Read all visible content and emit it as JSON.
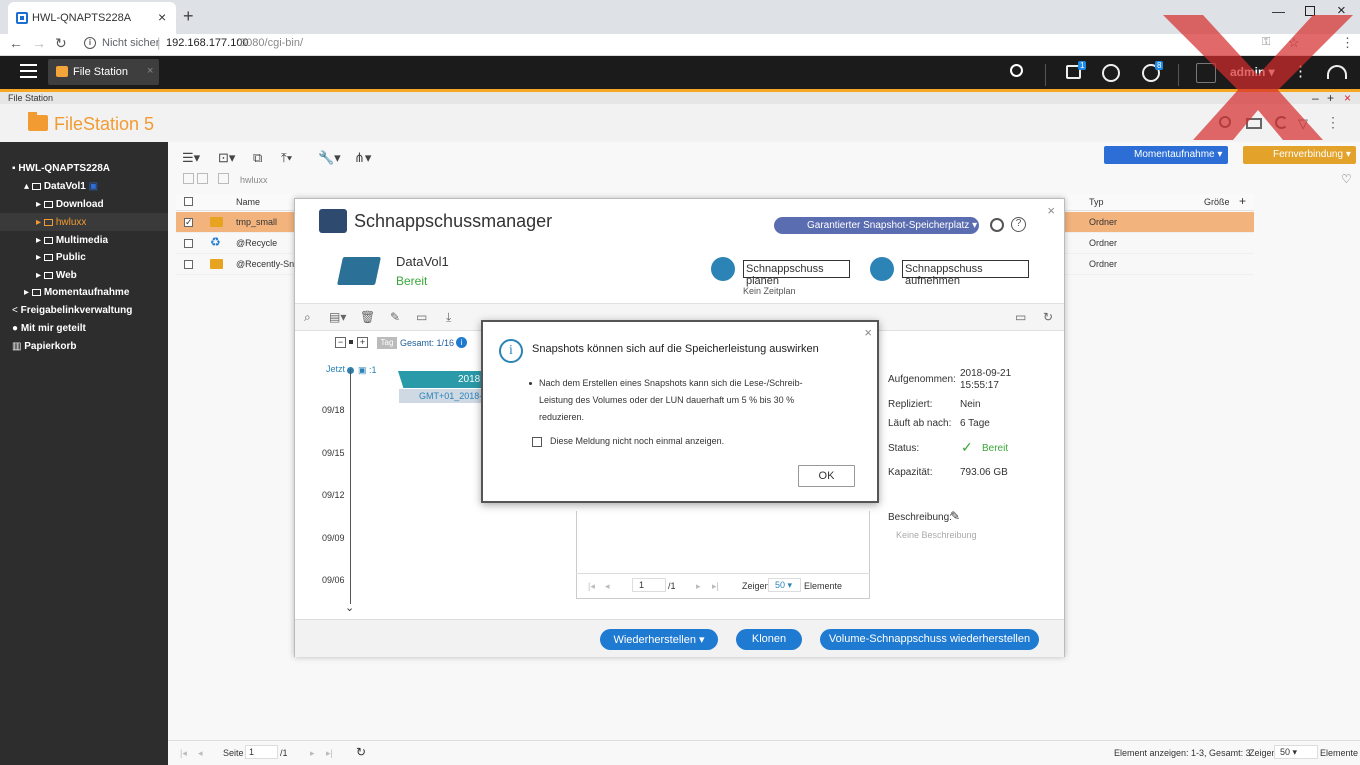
{
  "browser": {
    "tab_title": "HWL-QNAPTS228A",
    "security": "Nicht sicher",
    "url_host": "192.168.177.100",
    "url_path": ":8080/cgi-bin/"
  },
  "qts": {
    "app_tab": "File Station",
    "user": "admin",
    "badge_tasks": "1",
    "badge_info": "8"
  },
  "app": {
    "title_small": "File Station",
    "logo_main": "FileStation",
    "logo_version": " 5"
  },
  "sidebar": {
    "nas": "HWL-QNAPTS228A",
    "volume": "DataVol1",
    "folders": [
      "Download",
      "hwluxx",
      "Multimedia",
      "Public",
      "Web"
    ],
    "momentaufnahme": "Momentaufnahme",
    "freigabe": "Freigabelinkverwaltung",
    "shared": "Mit mir geteilt",
    "trash": "Papierkorb"
  },
  "toolbar": {
    "momentaufnahme_btn": "Momentaufnahme",
    "remote_btn": "Fernverbindung",
    "path": "hwluxx"
  },
  "table": {
    "headers": {
      "name": "Name",
      "type": "Typ",
      "size": "Größe"
    },
    "rows": [
      {
        "name": "tmp_small",
        "type": "Ordner",
        "checked": true
      },
      {
        "name": "@Recycle",
        "type": "Ordner",
        "checked": false
      },
      {
        "name": "@Recently-Snap",
        "type": "Ordner",
        "checked": false
      }
    ]
  },
  "statusbar": {
    "page_label": "Seite",
    "page_value": "1",
    "page_total": "/1",
    "items_info": "Element anzeigen: 1-3, Gesamt: 3",
    "show_label": "Zeigen",
    "show_value": "50",
    "elements_label": "Elemente"
  },
  "snapshot_manager": {
    "title": "Schnappschussmanager",
    "guarantee": "Garantierter Snapshot-Speicherplatz",
    "volume": "DataVol1",
    "volume_status": "Bereit",
    "plan_btn": "Schnappschuss planen",
    "take_btn": "Schnappschuss aufnehmen",
    "no_schedule": "Kein Zeitplan",
    "tag_label": "Tag",
    "total": "Gesamt: 1/16",
    "now": "Jetzt",
    "now_count": "1",
    "timeline_dates": [
      "09/18",
      "09/15",
      "09/12",
      "09/09",
      "09/06"
    ],
    "band_label": "2018",
    "snapshot_name": "GMT+01_2018-",
    "details": {
      "taken_label": "Aufgenommen:",
      "taken_value_1": "2018-09-21",
      "taken_value_2": "15:55:17",
      "replicated_label": "Repliziert:",
      "replicated_value": "Nein",
      "expires_label": "Läuft ab nach:",
      "expires_value": "6 Tage",
      "status_label": "Status:",
      "status_value": "Bereit",
      "capacity_label": "Kapazität:",
      "capacity_value": "793.06 GB",
      "desc_label": "Beschreibung:",
      "desc_value": "Keine Beschreibung"
    },
    "list_pager": {
      "page": "1",
      "total": "/1",
      "show_label": "Zeigen",
      "show_value": "50",
      "elements_label": "Elemente"
    },
    "buttons": {
      "restore": "Wiederherstellen",
      "clone": "Klonen",
      "volume_restore": "Volume-Schnappschuss wiederherstellen"
    }
  },
  "alert": {
    "title": "Snapshots können sich auf die Speicherleistung auswirken",
    "body": "Nach dem Erstellen eines Snapshots kann sich die Lese-/Schreib-Leistung des Volumes oder der LUN dauerhaft um 5 % bis 30 % reduzieren.",
    "checkbox_label": "Diese Meldung nicht noch einmal anzeigen.",
    "ok": "OK"
  },
  "colors": {
    "accent_orange": "#f29b33",
    "selection": "#f3b37d",
    "primary_blue": "#1f7ad1",
    "sidebar_bg": "#2d2d2d",
    "ready_green": "#3aa63a"
  }
}
